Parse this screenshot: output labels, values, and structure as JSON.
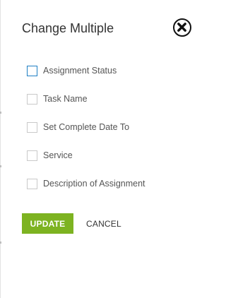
{
  "dialog": {
    "title": "Change Multiple",
    "close_icon": "close-circle-icon"
  },
  "options": [
    {
      "label": "Assignment Status",
      "checked": false,
      "focused": true
    },
    {
      "label": "Task Name",
      "checked": false,
      "focused": false
    },
    {
      "label": "Set Complete Date To",
      "checked": false,
      "focused": false
    },
    {
      "label": "Service",
      "checked": false,
      "focused": false
    },
    {
      "label": "Description of Assignment",
      "checked": false,
      "focused": false
    }
  ],
  "actions": {
    "update_label": "UPDATE",
    "cancel_label": "CANCEL"
  },
  "colors": {
    "accent": "#7db321",
    "focus_border": "#1f7fc4",
    "title_text": "#333333",
    "label_text": "#555555"
  }
}
